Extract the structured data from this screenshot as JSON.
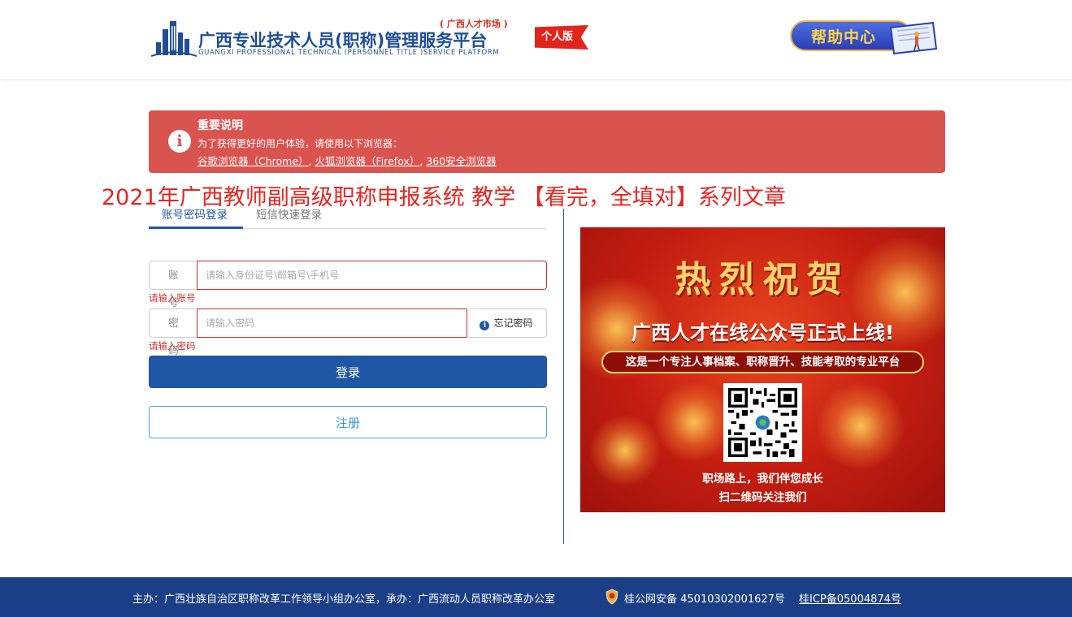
{
  "header": {
    "logo_title": "广西专业技术人员(职称)管理服务平台",
    "logo_subtitle": "GUANGXI PROFESSIONAL TECHNICAL (PERSONNEL TITLE )SERVICE PLATFORM",
    "logo_market": "( 广西人才市场 )",
    "logo_badge": "个人版",
    "help_label": "帮助中心"
  },
  "notice": {
    "title": "重要说明",
    "line": "为了获得更好的用户体验，请使用以下浏览器：",
    "links": [
      "谷歌浏览器（Chrome）",
      "火狐浏览器（Firefox）",
      "360安全浏览器"
    ]
  },
  "overlay_title": "2021年广西教师副高级职称申报系统 教学 【看完，全填对】系列文章",
  "login": {
    "tabs": [
      "账号密码登录",
      "短信快速登录"
    ],
    "account_label": "账号",
    "account_placeholder": "请输入身份证号\\邮箱号\\手机号",
    "account_error": "请输入账号",
    "password_label": "密码",
    "password_placeholder": "请输入密码",
    "password_error": "请输入密码",
    "forgot_label": "忘记密码",
    "login_button": "登录",
    "register_button": "注册"
  },
  "banner": {
    "heading": "热烈祝贺",
    "main": "广西人才在线公众号正式上线!",
    "strip": "这是一个专注人事档案、职称晋升、技能考取的专业平台",
    "line1": "职场路上，我们伴您成长",
    "line2": "扫二维码关注我们"
  },
  "footer": {
    "text": "主办：广西壮族自治区职称改革工作领导小组办公室，承办：广西流动人员职称改革办公室",
    "psb": "桂公网安备 45010302001627号",
    "icp": "桂ICP备05004874号"
  },
  "colors": {
    "brand_blue": "#1f57a4",
    "notice_red": "#d9534f",
    "footer_blue": "#1b3f86",
    "error_red": "#c9302c"
  }
}
